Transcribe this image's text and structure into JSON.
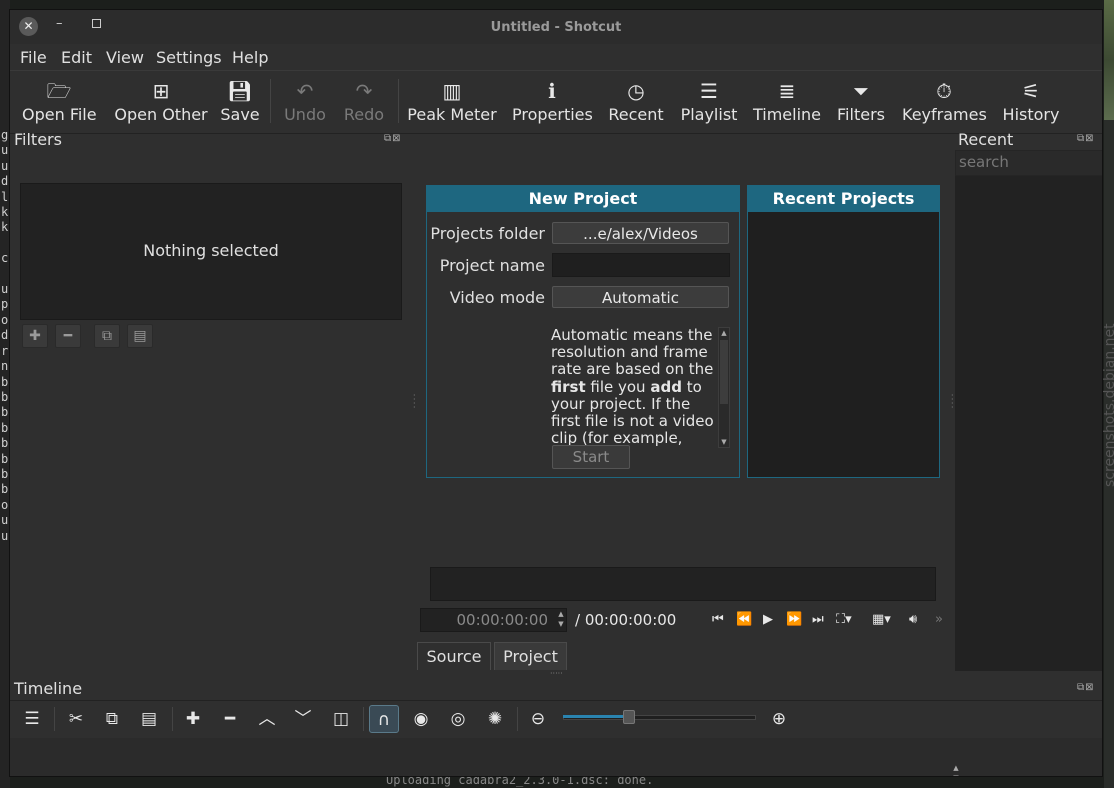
{
  "window": {
    "title": "Untitled - Shotcut",
    "close_symbol": "✕",
    "min_symbol": "–"
  },
  "menu": {
    "file": "File",
    "edit": "Edit",
    "view": "View",
    "settings": "Settings",
    "help": "Help"
  },
  "toolbar": {
    "open_file": "Open File",
    "open_other": "Open Other",
    "save": "Save",
    "undo": "Undo",
    "redo": "Redo",
    "peak_meter": "Peak Meter",
    "properties": "Properties",
    "recent": "Recent",
    "playlist": "Playlist",
    "timeline": "Timeline",
    "filters": "Filters",
    "keyframes": "Keyframes",
    "history": "History"
  },
  "filters_dock": {
    "title": "Filters",
    "empty_text": "Nothing selected"
  },
  "new_project": {
    "header": "New Project",
    "projects_folder_label": "Projects folder",
    "projects_folder_value": "...e/alex/Videos",
    "project_name_label": "Project name",
    "project_name_value": "",
    "video_mode_label": "Video mode",
    "video_mode_value": "Automatic",
    "description_1": "Automatic means the resolution and frame rate are based on the ",
    "description_bold_1": "first",
    "description_2": " file you ",
    "description_bold_2": "add",
    "description_3": " to your project. If the first file is not a video clip (for example,",
    "start_label": "Start"
  },
  "recent_projects": {
    "header": "Recent Projects"
  },
  "player": {
    "position": "00:00:00:00",
    "duration": "/ 00:00:00:00",
    "tab_source": "Source",
    "tab_project": "Project"
  },
  "recent_dock": {
    "title": "Recent",
    "search_placeholder": "search"
  },
  "timeline_dock": {
    "title": "Timeline",
    "zoom_level": 0.34
  },
  "background": {
    "left_text": "g\nu\nu\nd\nl\nk\nk\n\nc\n\nu\np\no\nd\nr\nn\nb\nb\nb\nb\nb\nb\nb\nb\no\nu\nu",
    "bottom_text": "Uploading cadabra2_2.3.0-1.dsc: done.",
    "watermark": "screenshots.debian.net"
  },
  "colors": {
    "accent": "#1e6780",
    "window_bg": "#2f2f2f",
    "panel_dark": "#222222"
  }
}
